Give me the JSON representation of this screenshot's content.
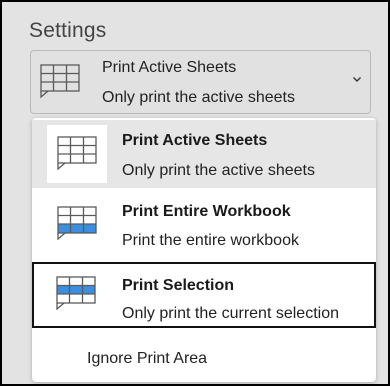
{
  "section": {
    "heading": "Settings"
  },
  "dropdown": {
    "title": "Print Active Sheets",
    "subtitle": "Only print the active sheets",
    "chevron_icon": "chevron-down-icon"
  },
  "menu": {
    "items": [
      {
        "title": "Print Active Sheets",
        "description": "Only print the active sheets",
        "icon": "sheet-icon",
        "highlighted": true
      },
      {
        "title": "Print Entire Workbook",
        "description": "Print the entire workbook",
        "icon": "workbook-icon",
        "highlighted": false
      },
      {
        "title": "Print Selection",
        "description": "Only print the current selection",
        "icon": "selection-icon",
        "highlighted": false,
        "focused": true
      }
    ],
    "ignore_label": "Ignore Print Area"
  },
  "colors": {
    "accent_blue": "#3a8fe0",
    "grid_gray": "#5a5a5a",
    "focus_border": "#111111",
    "hover_bg": "#e6e6e6"
  }
}
